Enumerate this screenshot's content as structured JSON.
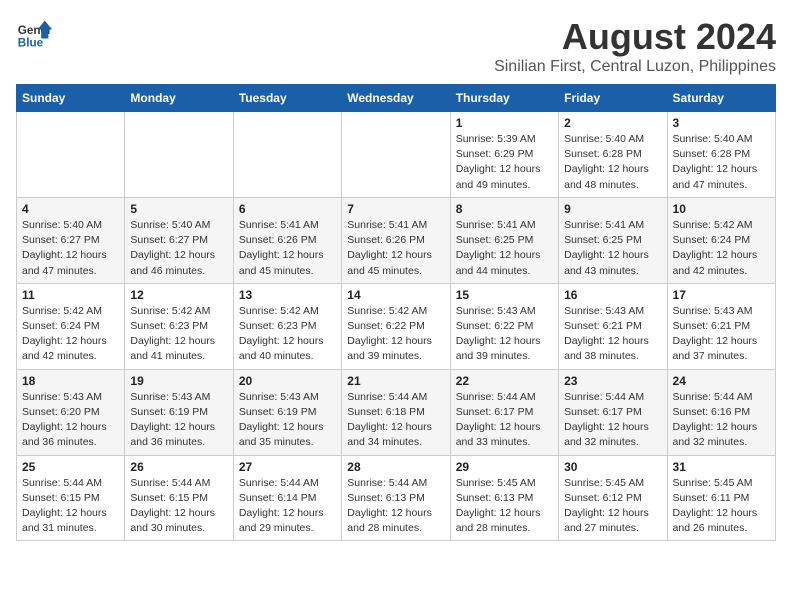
{
  "header": {
    "logo_line1": "General",
    "logo_line2": "Blue",
    "month_year": "August 2024",
    "location": "Sinilian First, Central Luzon, Philippines"
  },
  "days_of_week": [
    "Sunday",
    "Monday",
    "Tuesday",
    "Wednesday",
    "Thursday",
    "Friday",
    "Saturday"
  ],
  "weeks": [
    [
      {
        "day": "",
        "info": ""
      },
      {
        "day": "",
        "info": ""
      },
      {
        "day": "",
        "info": ""
      },
      {
        "day": "",
        "info": ""
      },
      {
        "day": "1",
        "info": "Sunrise: 5:39 AM\nSunset: 6:29 PM\nDaylight: 12 hours\nand 49 minutes."
      },
      {
        "day": "2",
        "info": "Sunrise: 5:40 AM\nSunset: 6:28 PM\nDaylight: 12 hours\nand 48 minutes."
      },
      {
        "day": "3",
        "info": "Sunrise: 5:40 AM\nSunset: 6:28 PM\nDaylight: 12 hours\nand 47 minutes."
      }
    ],
    [
      {
        "day": "4",
        "info": "Sunrise: 5:40 AM\nSunset: 6:27 PM\nDaylight: 12 hours\nand 47 minutes."
      },
      {
        "day": "5",
        "info": "Sunrise: 5:40 AM\nSunset: 6:27 PM\nDaylight: 12 hours\nand 46 minutes."
      },
      {
        "day": "6",
        "info": "Sunrise: 5:41 AM\nSunset: 6:26 PM\nDaylight: 12 hours\nand 45 minutes."
      },
      {
        "day": "7",
        "info": "Sunrise: 5:41 AM\nSunset: 6:26 PM\nDaylight: 12 hours\nand 45 minutes."
      },
      {
        "day": "8",
        "info": "Sunrise: 5:41 AM\nSunset: 6:25 PM\nDaylight: 12 hours\nand 44 minutes."
      },
      {
        "day": "9",
        "info": "Sunrise: 5:41 AM\nSunset: 6:25 PM\nDaylight: 12 hours\nand 43 minutes."
      },
      {
        "day": "10",
        "info": "Sunrise: 5:42 AM\nSunset: 6:24 PM\nDaylight: 12 hours\nand 42 minutes."
      }
    ],
    [
      {
        "day": "11",
        "info": "Sunrise: 5:42 AM\nSunset: 6:24 PM\nDaylight: 12 hours\nand 42 minutes."
      },
      {
        "day": "12",
        "info": "Sunrise: 5:42 AM\nSunset: 6:23 PM\nDaylight: 12 hours\nand 41 minutes."
      },
      {
        "day": "13",
        "info": "Sunrise: 5:42 AM\nSunset: 6:23 PM\nDaylight: 12 hours\nand 40 minutes."
      },
      {
        "day": "14",
        "info": "Sunrise: 5:42 AM\nSunset: 6:22 PM\nDaylight: 12 hours\nand 39 minutes."
      },
      {
        "day": "15",
        "info": "Sunrise: 5:43 AM\nSunset: 6:22 PM\nDaylight: 12 hours\nand 39 minutes."
      },
      {
        "day": "16",
        "info": "Sunrise: 5:43 AM\nSunset: 6:21 PM\nDaylight: 12 hours\nand 38 minutes."
      },
      {
        "day": "17",
        "info": "Sunrise: 5:43 AM\nSunset: 6:21 PM\nDaylight: 12 hours\nand 37 minutes."
      }
    ],
    [
      {
        "day": "18",
        "info": "Sunrise: 5:43 AM\nSunset: 6:20 PM\nDaylight: 12 hours\nand 36 minutes."
      },
      {
        "day": "19",
        "info": "Sunrise: 5:43 AM\nSunset: 6:19 PM\nDaylight: 12 hours\nand 36 minutes."
      },
      {
        "day": "20",
        "info": "Sunrise: 5:43 AM\nSunset: 6:19 PM\nDaylight: 12 hours\nand 35 minutes."
      },
      {
        "day": "21",
        "info": "Sunrise: 5:44 AM\nSunset: 6:18 PM\nDaylight: 12 hours\nand 34 minutes."
      },
      {
        "day": "22",
        "info": "Sunrise: 5:44 AM\nSunset: 6:17 PM\nDaylight: 12 hours\nand 33 minutes."
      },
      {
        "day": "23",
        "info": "Sunrise: 5:44 AM\nSunset: 6:17 PM\nDaylight: 12 hours\nand 32 minutes."
      },
      {
        "day": "24",
        "info": "Sunrise: 5:44 AM\nSunset: 6:16 PM\nDaylight: 12 hours\nand 32 minutes."
      }
    ],
    [
      {
        "day": "25",
        "info": "Sunrise: 5:44 AM\nSunset: 6:15 PM\nDaylight: 12 hours\nand 31 minutes."
      },
      {
        "day": "26",
        "info": "Sunrise: 5:44 AM\nSunset: 6:15 PM\nDaylight: 12 hours\nand 30 minutes."
      },
      {
        "day": "27",
        "info": "Sunrise: 5:44 AM\nSunset: 6:14 PM\nDaylight: 12 hours\nand 29 minutes."
      },
      {
        "day": "28",
        "info": "Sunrise: 5:44 AM\nSunset: 6:13 PM\nDaylight: 12 hours\nand 28 minutes."
      },
      {
        "day": "29",
        "info": "Sunrise: 5:45 AM\nSunset: 6:13 PM\nDaylight: 12 hours\nand 28 minutes."
      },
      {
        "day": "30",
        "info": "Sunrise: 5:45 AM\nSunset: 6:12 PM\nDaylight: 12 hours\nand 27 minutes."
      },
      {
        "day": "31",
        "info": "Sunrise: 5:45 AM\nSunset: 6:11 PM\nDaylight: 12 hours\nand 26 minutes."
      }
    ]
  ]
}
